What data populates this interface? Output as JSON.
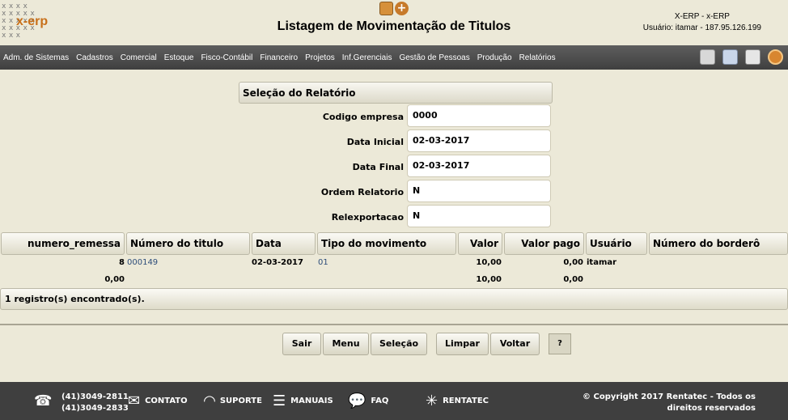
{
  "header": {
    "logo_text": "x-erp",
    "title": "Listagem de Movimentação de Titulos",
    "system": "X-ERP - x-ERP",
    "user": "Usuário: itamar - 187.95.126.199",
    "add_icon": "plus-icon",
    "doc_icon": "document-icon"
  },
  "menu": {
    "items": [
      "Adm. de Sistemas",
      "Cadastros",
      "Comercial",
      "Estoque",
      "Fisco-Contábil",
      "Financeiro",
      "Projetos",
      "Inf.Gerenciais",
      "Gestão de Pessoas",
      "Produção",
      "Relatórios"
    ],
    "tool_icons": [
      "home-icon",
      "page-icon",
      "print-icon",
      "exit-icon"
    ]
  },
  "form": {
    "section_title": "Seleção do Relatório",
    "fields": [
      {
        "label": "Codigo empresa",
        "value": "0000"
      },
      {
        "label": "Data Inicial",
        "value": "02-03-2017"
      },
      {
        "label": "Data Final",
        "value": "02-03-2017"
      },
      {
        "label": "Ordem Relatorio",
        "value": "N"
      },
      {
        "label": "Relexportacao",
        "value": "N"
      }
    ]
  },
  "table": {
    "columns": [
      "numero_remessa",
      "Número do titulo",
      "Data",
      "Tipo do movimento",
      "Valor",
      "Valor pago",
      "Usuário",
      "Número do borderô"
    ],
    "rows": [
      {
        "numero_remessa": "8",
        "numero_titulo": "000149",
        "data": "02-03-2017",
        "tipo": "01",
        "valor": "10,00",
        "valor_pago": "0,00",
        "usuario": "itamar",
        "bordero": ""
      }
    ],
    "totals": {
      "numero_remessa": "0,00",
      "valor": "10,00",
      "valor_pago": "0,00"
    },
    "count_text": "1 registro(s) encontrado(s)."
  },
  "buttons": {
    "sair": "Sair",
    "menu": "Menu",
    "selecao": "Seleção",
    "limpar": "Limpar",
    "voltar": "Voltar",
    "help": "?"
  },
  "footer": {
    "phone1": "(41)3049-2811",
    "phone2": "(41)3049-2833",
    "contato": "CONTATO",
    "suporte": "SUPORTE",
    "manuais": "MANUAIS",
    "faq": "FAQ",
    "rentatec": "RENTATEC",
    "copyright": "© Copyright 2017 Rentatec - Todos os direitos reservados",
    "icons": [
      "phone-icon",
      "mail-icon",
      "headset-icon",
      "books-icon",
      "faq-icon",
      "network-icon"
    ]
  },
  "colors": {
    "background": "#ece9d8",
    "menubar": "#4a4a4a",
    "footer": "#3f3f3f",
    "accent": "#c8701a",
    "link": "#2d4d7a"
  }
}
